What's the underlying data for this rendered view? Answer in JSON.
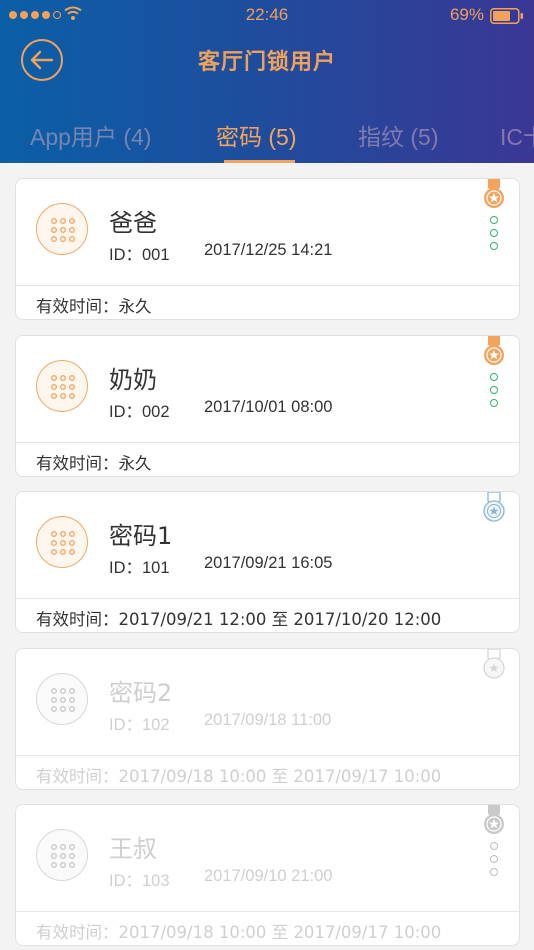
{
  "status_bar": {
    "time": "22:46",
    "battery": "69%"
  },
  "header": {
    "title": "客厅门锁用户"
  },
  "tabs": [
    {
      "label": "App用户 (4)",
      "active": false
    },
    {
      "label": "密码 (5)",
      "active": true
    },
    {
      "label": "指纹 (5)",
      "active": false
    },
    {
      "label": "IC卡",
      "active": false
    }
  ],
  "colors": {
    "accent": "#f3a45c",
    "more_green": "#2fb56e",
    "header_start": "#0b5fa6",
    "header_end": "#3a3795"
  },
  "cards": [
    {
      "name": "爸爸",
      "id": "ID：001",
      "created": "2017/12/25 14:21",
      "validity": "有效时间：永久",
      "badge": "gold-medal-icon",
      "has_menu": true,
      "enabled": true
    },
    {
      "name": "奶奶",
      "id": "ID：002",
      "created": "2017/10/01 08:00",
      "validity": "有效时间：永久",
      "badge": "gold-medal-icon",
      "has_menu": true,
      "enabled": true
    },
    {
      "name": "密码1",
      "id": "ID：101",
      "created": "2017/09/21 16:05",
      "validity": "有效时间：2017/09/21 12:00 至 2017/10/20 12:00",
      "badge": "silver-medal-icon",
      "has_menu": false,
      "enabled": true
    },
    {
      "name": "密码2",
      "id": "ID：102",
      "created": "2017/09/18 11:00",
      "validity": "有效时间：2017/09/18 10:00 至 2017/09/17 10:00",
      "badge": "grey-medal-icon",
      "has_menu": false,
      "enabled": false
    },
    {
      "name": "王叔",
      "id": "ID：103",
      "created": "2017/09/10 21:00",
      "validity": "有效时间：2017/09/18 10:00 至 2017/09/17 10:00",
      "badge": "grey-medal-icon",
      "has_menu": true,
      "enabled": false
    }
  ]
}
